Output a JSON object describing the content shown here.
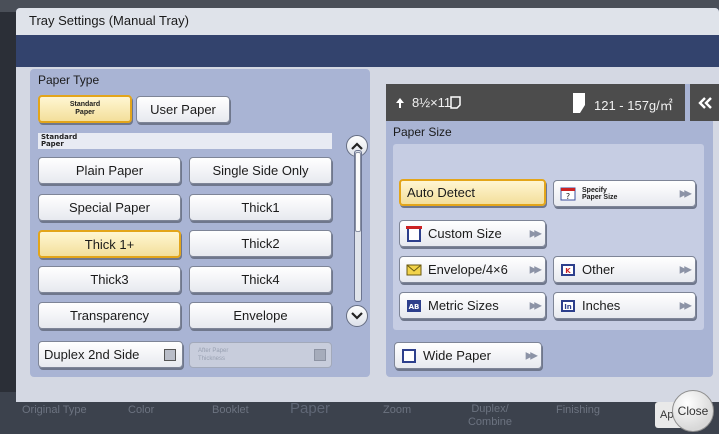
{
  "dialog": {
    "title": "Tray Settings (Manual Tray)"
  },
  "paper_type": {
    "label": "Paper Type",
    "tabs": {
      "standard": "Standard Paper",
      "user": "User Paper"
    },
    "subheader": "Standard Paper",
    "buttons": [
      "Plain Paper",
      "Single Side Only",
      "Special Paper",
      "Thick1",
      "Thick 1+",
      "Thick2",
      "Thick3",
      "Thick4",
      "Transparency",
      "Envelope"
    ],
    "selected": "Thick 1+",
    "duplex_label": "Duplex 2nd Side",
    "after_paper_label": "After Paper Thickness"
  },
  "status": {
    "size_value": "8½×11",
    "weight_value": "121 - 157g/㎡"
  },
  "paper_size": {
    "label": "Paper Size",
    "auto_detect": "Auto Detect",
    "specify": "Specify Paper Size",
    "custom": "Custom Size",
    "envelope": "Envelope/4×6",
    "other": "Other",
    "metric": "Metric Sizes",
    "inches": "Inches",
    "wide": "Wide Paper"
  },
  "bottom_tabs": [
    "Original Type",
    "Color",
    "Booklet",
    "Paper",
    "Zoom",
    "Duplex/ Combine",
    "Finishing"
  ],
  "apply_chip": "Ap",
  "close_label": "Close",
  "colors": {
    "accent_border": "#e3a51a",
    "panel_bg": "#a9b4d4",
    "header_band": "#33436d"
  }
}
